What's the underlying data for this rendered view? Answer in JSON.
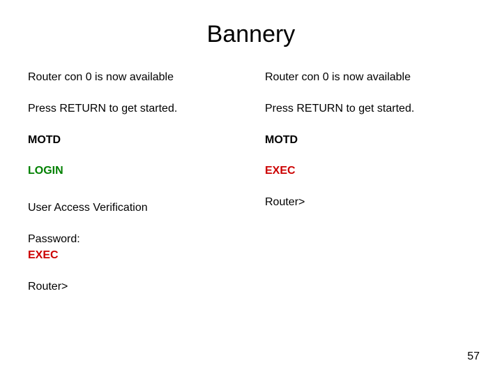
{
  "title": "Bannery",
  "left": {
    "line1": "Router con 0 is now available",
    "line2": "Press RETURN to get started.",
    "motd": "MOTD",
    "login": "LOGIN",
    "uav": "User Access Verification",
    "password": "Password:",
    "exec": "EXEC",
    "prompt": "Router>"
  },
  "right": {
    "line1": "Router con 0 is now available",
    "line2": "Press RETURN to get started.",
    "motd": "MOTD",
    "exec": "EXEC",
    "prompt": "Router>"
  },
  "page_number": "57"
}
